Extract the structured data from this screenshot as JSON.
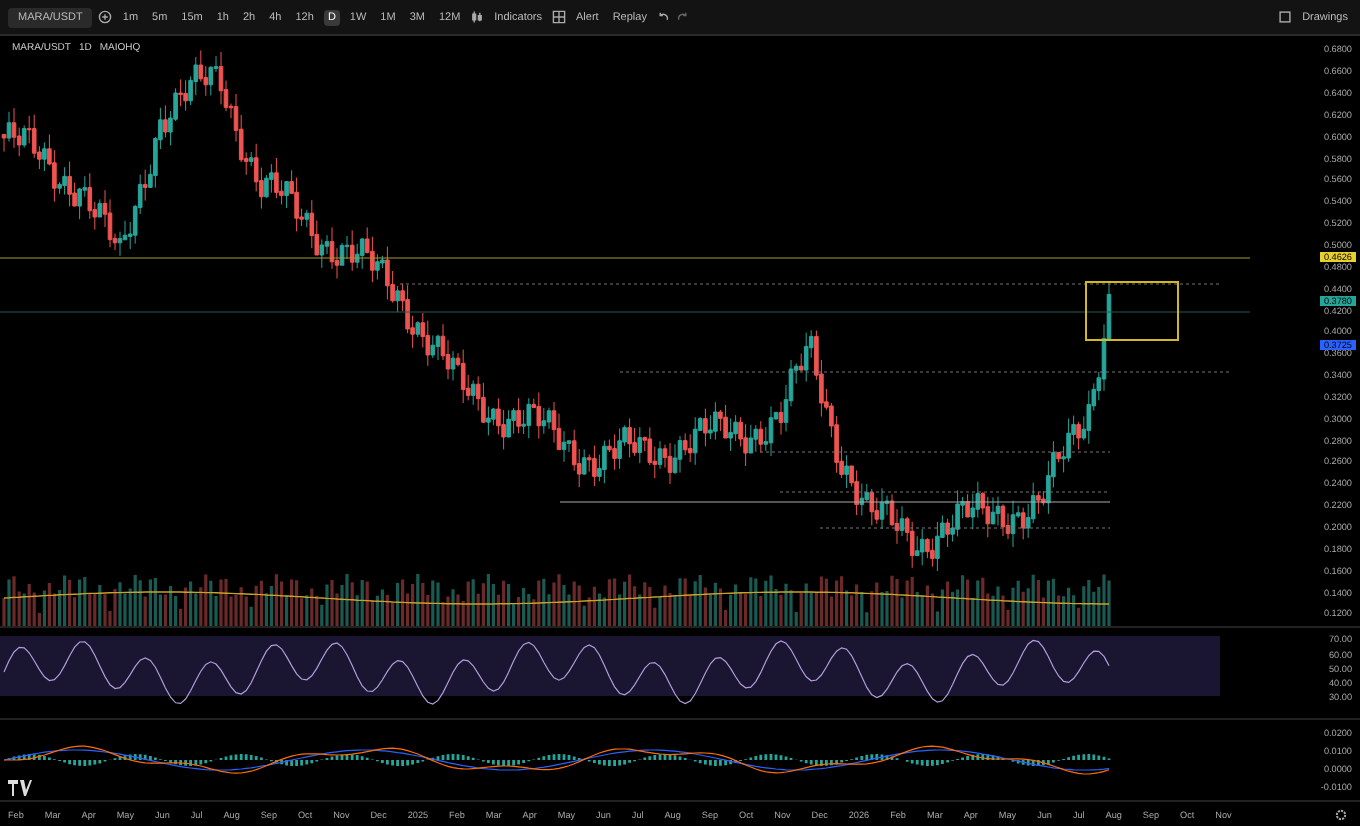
{
  "toolbar": {
    "symbol": "MARA/USDT",
    "intervals": [
      {
        "label": "1m",
        "selected": false
      },
      {
        "label": "5m",
        "selected": false
      },
      {
        "label": "15m",
        "selected": false
      },
      {
        "label": "1h",
        "selected": false
      },
      {
        "label": "2h",
        "selected": false
      },
      {
        "label": "4h",
        "selected": false
      },
      {
        "label": "12h",
        "selected": false
      },
      {
        "label": "D",
        "selected": true
      },
      {
        "label": "1W",
        "selected": false
      },
      {
        "label": "1M",
        "selected": false
      },
      {
        "label": "3M",
        "selected": false
      },
      {
        "label": "12M",
        "selected": false
      }
    ],
    "indicators": "Indicators",
    "alert": "Alert",
    "replay": "Replay",
    "drawings": "Drawings"
  },
  "legend": {
    "symbol": "MARA/USDT",
    "interval": "1D",
    "exchange": "MAIOHQ"
  },
  "price_axis": [
    "0.6800",
    "0.6600",
    "0.6400",
    "0.6200",
    "0.6000",
    "0.5800",
    "0.5600",
    "0.5400",
    "0.5200",
    "0.5000",
    "0.4800",
    "0.4400",
    "0.4200",
    "0.4000",
    "0.3600",
    "0.3400",
    "0.3200",
    "0.3000",
    "0.2800",
    "0.2600",
    "0.2400",
    "0.2200",
    "0.2000",
    "0.1800",
    "0.1600",
    "0.1400",
    "0.1200"
  ],
  "price_badges": [
    {
      "text": "0.4626",
      "color": "#e8d12c"
    },
    {
      "text": "0.3780",
      "color": "#26a69a"
    },
    {
      "text": "0.3725",
      "color": "#2962ff"
    }
  ],
  "rsi_axis": [
    "70.00",
    "60.00",
    "50.00",
    "40.00",
    "30.00"
  ],
  "macd_axis": [
    "0.0200",
    "0.0100",
    "0.0000",
    "-0.0100"
  ],
  "time_axis": [
    "Feb",
    "Mar",
    "Apr",
    "May",
    "Jun",
    "Jul",
    "Aug",
    "Sep",
    "Oct",
    "Nov",
    "Dec",
    "2025",
    "Feb",
    "Mar",
    "Apr",
    "May",
    "Jun",
    "Jul",
    "Aug",
    "Sep",
    "Oct",
    "Nov",
    "Dec",
    "2026",
    "Feb",
    "Mar",
    "Apr",
    "May",
    "Jun",
    "Jul",
    "Aug",
    "Sep",
    "Oct",
    "Nov"
  ]
}
